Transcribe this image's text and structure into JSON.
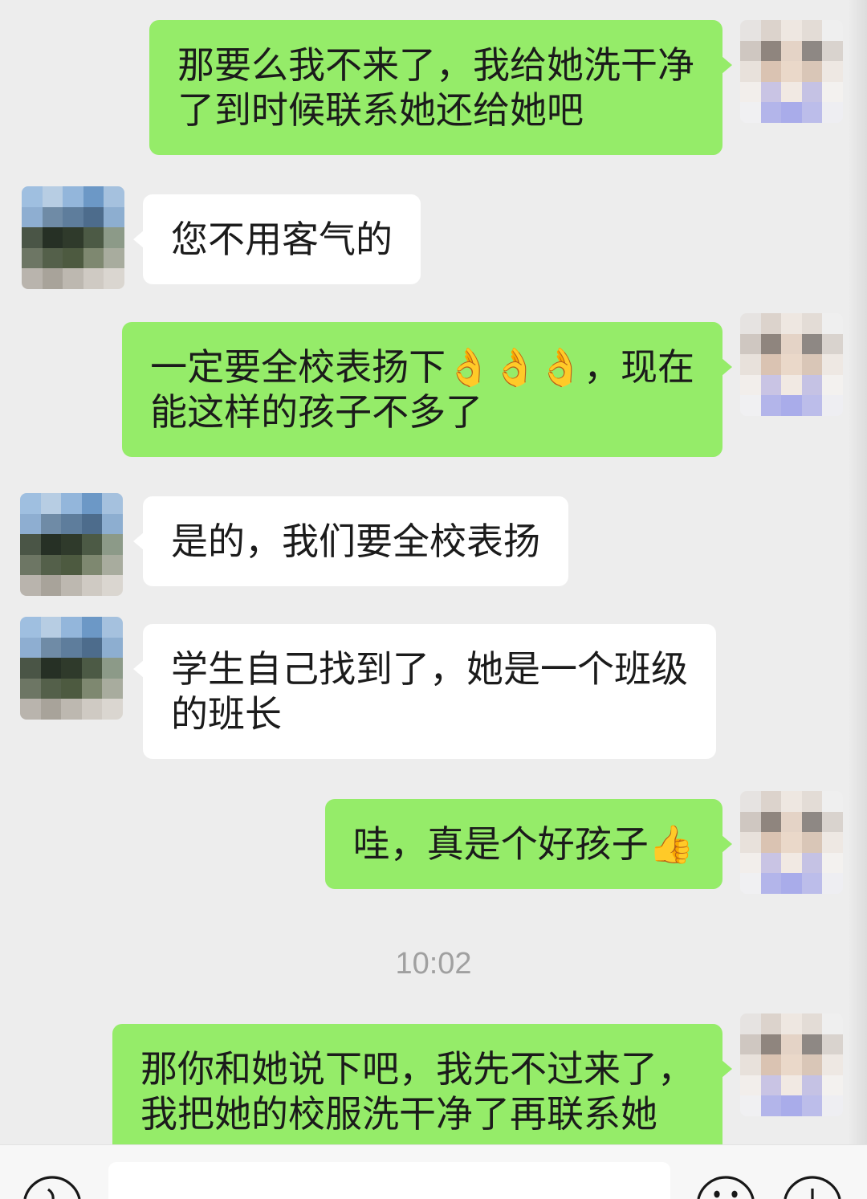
{
  "theme": {
    "background": "#EDEDED",
    "sent_bubble": "#95EC69",
    "received_bubble": "#FFFFFF",
    "text": "#1B1B1B",
    "time_text": "#A0A0A0",
    "input_bar": "#F7F7F7"
  },
  "chat": {
    "messages": [
      {
        "outgoing": true,
        "lines": [
          "那要么我不来了，我给她洗干净",
          "了到时候联系她还给她吧"
        ]
      },
      {
        "outgoing": false,
        "lines": [
          "您不用客气的"
        ]
      },
      {
        "outgoing": true,
        "lines": [
          "一定要全校表扬下👌👌👌，现在",
          "能这样的孩子不多了"
        ]
      },
      {
        "outgoing": false,
        "lines": [
          "是的，我们要全校表扬"
        ]
      },
      {
        "outgoing": false,
        "lines": [
          "学生自己找到了，她是一个班级",
          "的班长"
        ]
      },
      {
        "outgoing": true,
        "lines": [
          "哇，真是个好孩子👍"
        ]
      },
      {
        "outgoing": true,
        "lines": [
          "那你和她说下吧，我先不过来了，",
          "我把她的校服洗干净了再联系她"
        ]
      }
    ],
    "time_divider": "10:02"
  },
  "input_bar": {
    "voice_icon": "voice-icon",
    "emoji_icon": "emoji-icon",
    "plus_icon": "plus-icon",
    "input_value": ""
  }
}
